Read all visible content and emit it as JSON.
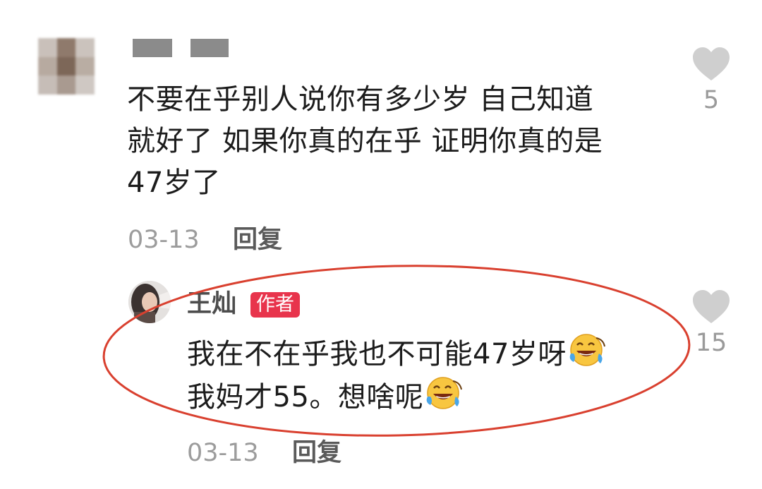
{
  "comment": {
    "lines": [
      "不要在乎别人说你有多少岁 自己知道",
      "就好了 如果你真的在乎 证明你真的是",
      "47岁了"
    ],
    "date": "03-13",
    "reply_label": "回复",
    "like_count": "5"
  },
  "reply": {
    "author_name": "王灿",
    "author_badge": "作者",
    "line1": "我在不在乎我也不可能47岁呀",
    "line2": "我妈才55。想啥呢",
    "emoji": "laughing-crying-emoji",
    "date": "03-13",
    "reply_label": "回复",
    "like_count": "15"
  },
  "colors": {
    "badge": "#e8344c",
    "annotation_circle": "#d9402f",
    "heart": "#cfcfcf"
  }
}
